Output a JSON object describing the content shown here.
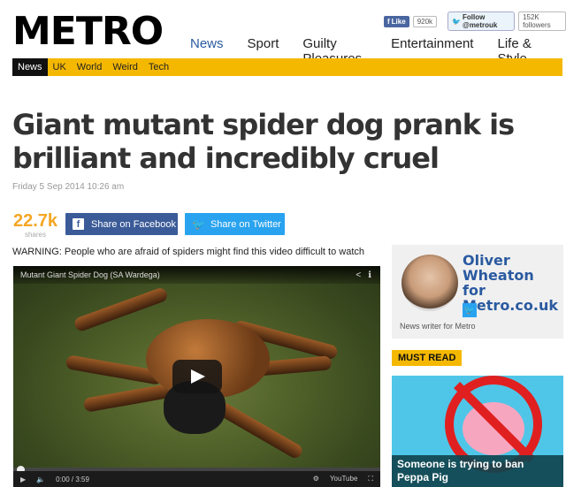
{
  "site": {
    "logo": "METRO",
    "facebook_like_label": "Like",
    "facebook_like_count": "920k",
    "twitter_follow_label": "Follow @metrouk",
    "twitter_followers": "152K followers"
  },
  "main_nav": [
    {
      "label": "News",
      "active": true
    },
    {
      "label": "Sport",
      "active": false
    },
    {
      "label": "Guilty Pleasures",
      "active": false
    },
    {
      "label": "Entertainment",
      "active": false
    },
    {
      "label": "Life & Style",
      "active": false
    }
  ],
  "sub_nav": [
    {
      "label": "News",
      "current": true
    },
    {
      "label": "UK",
      "current": false
    },
    {
      "label": "World",
      "current": false
    },
    {
      "label": "Weird",
      "current": false
    },
    {
      "label": "Tech",
      "current": false
    }
  ],
  "article": {
    "headline": "Giant mutant spider dog prank is brilliant and incredibly cruel",
    "date": "Friday 5 Sep 2014 10:26 am",
    "share_count": "22.7k",
    "share_count_label": "shares",
    "share_facebook": "Share on Facebook",
    "share_twitter": "Share on Twitter",
    "warning": "WARNING: People who are afraid of spiders might find this video difficult to watch"
  },
  "video": {
    "title": "Mutant Giant Spider Dog (SA Wardega)",
    "time": "0:00 / 3:59",
    "brand": "YouTube"
  },
  "author": {
    "name": "Oliver Wheaton for Metro.co.uk",
    "role": "News writer for Metro"
  },
  "sidebar": {
    "must_read_label": "MUST READ",
    "promo_caption": "Someone is trying to ban Peppa Pig"
  },
  "colors": {
    "brand_yellow": "#f5b800",
    "nav_active": "#2a5aa0",
    "facebook": "#3b5b98",
    "twitter": "#29a3ef",
    "share_count": "#f5a623"
  }
}
